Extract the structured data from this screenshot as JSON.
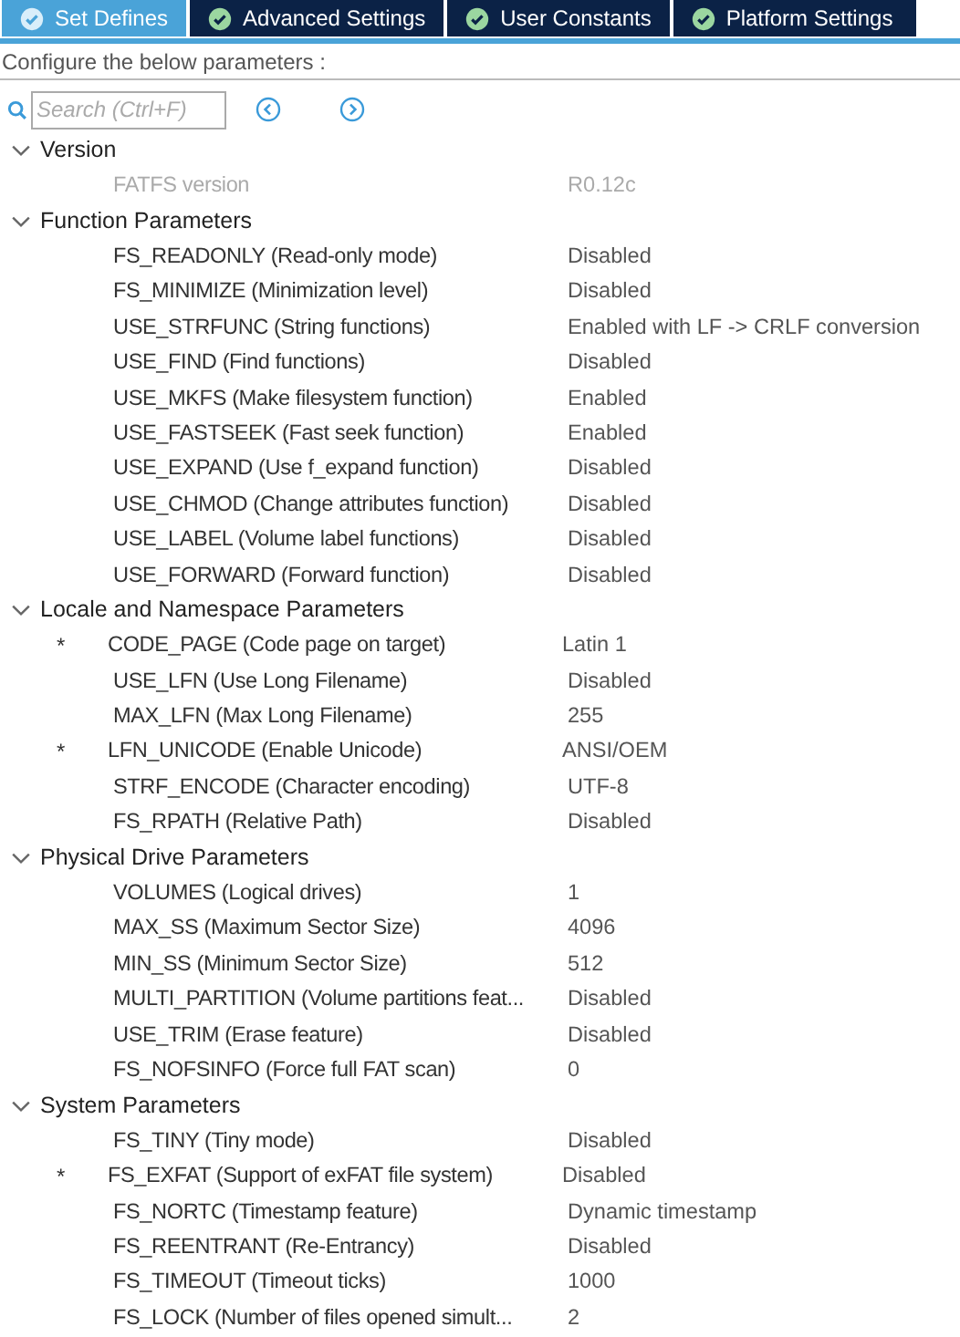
{
  "tabs": [
    {
      "label": "Set Defines",
      "selected": true
    },
    {
      "label": "Advanced Settings",
      "selected": false
    },
    {
      "label": "User Constants",
      "selected": false
    },
    {
      "label": "Platform Settings",
      "selected": false
    }
  ],
  "caption": "Configure the below parameters :",
  "search": {
    "placeholder": "Search (Ctrl+F)"
  },
  "groups": [
    {
      "title": "Version",
      "expanded": true,
      "params": [
        {
          "name": "FATFS version",
          "value": "R0.12c",
          "starred": false,
          "disabled": true
        }
      ]
    },
    {
      "title": "Function Parameters",
      "expanded": true,
      "params": [
        {
          "name": "FS_READONLY (Read-only mode)",
          "value": "Disabled",
          "starred": false,
          "disabled": false
        },
        {
          "name": "FS_MINIMIZE (Minimization level)",
          "value": "Disabled",
          "starred": false,
          "disabled": false
        },
        {
          "name": "USE_STRFUNC (String functions)",
          "value": "Enabled with LF -> CRLF conversion",
          "starred": false,
          "disabled": false
        },
        {
          "name": "USE_FIND (Find functions)",
          "value": "Disabled",
          "starred": false,
          "disabled": false
        },
        {
          "name": "USE_MKFS (Make filesystem function)",
          "value": "Enabled",
          "starred": false,
          "disabled": false
        },
        {
          "name": "USE_FASTSEEK (Fast seek function)",
          "value": "Enabled",
          "starred": false,
          "disabled": false
        },
        {
          "name": "USE_EXPAND (Use f_expand function)",
          "value": "Disabled",
          "starred": false,
          "disabled": false
        },
        {
          "name": "USE_CHMOD (Change attributes function)",
          "value": "Disabled",
          "starred": false,
          "disabled": false
        },
        {
          "name": "USE_LABEL (Volume label functions)",
          "value": "Disabled",
          "starred": false,
          "disabled": false
        },
        {
          "name": "USE_FORWARD (Forward function)",
          "value": "Disabled",
          "starred": false,
          "disabled": false
        }
      ]
    },
    {
      "title": "Locale and Namespace Parameters",
      "expanded": true,
      "params": [
        {
          "name": "CODE_PAGE (Code page on target)",
          "value": "Latin 1",
          "starred": true,
          "disabled": false
        },
        {
          "name": "USE_LFN (Use Long Filename)",
          "value": "Disabled",
          "starred": false,
          "disabled": false
        },
        {
          "name": "MAX_LFN (Max Long Filename)",
          "value": "255",
          "starred": false,
          "disabled": false
        },
        {
          "name": "LFN_UNICODE (Enable Unicode)",
          "value": "ANSI/OEM",
          "starred": true,
          "disabled": false
        },
        {
          "name": "STRF_ENCODE (Character encoding)",
          "value": "UTF-8",
          "starred": false,
          "disabled": false
        },
        {
          "name": "FS_RPATH (Relative Path)",
          "value": "Disabled",
          "starred": false,
          "disabled": false
        }
      ]
    },
    {
      "title": "Physical Drive Parameters",
      "expanded": true,
      "params": [
        {
          "name": "VOLUMES (Logical drives)",
          "value": "1",
          "starred": false,
          "disabled": false
        },
        {
          "name": "MAX_SS (Maximum Sector Size)",
          "value": "4096",
          "starred": false,
          "disabled": false
        },
        {
          "name": "MIN_SS (Minimum Sector Size)",
          "value": "512",
          "starred": false,
          "disabled": false
        },
        {
          "name": "MULTI_PARTITION (Volume partitions feat...",
          "value": "Disabled",
          "starred": false,
          "disabled": false
        },
        {
          "name": "USE_TRIM (Erase feature)",
          "value": "Disabled",
          "starred": false,
          "disabled": false
        },
        {
          "name": "FS_NOFSINFO (Force full FAT scan)",
          "value": "0",
          "starred": false,
          "disabled": false
        }
      ]
    },
    {
      "title": "System Parameters",
      "expanded": true,
      "params": [
        {
          "name": "FS_TINY (Tiny mode)",
          "value": "Disabled",
          "starred": false,
          "disabled": false
        },
        {
          "name": "FS_EXFAT (Support of exFAT file system)",
          "value": "Disabled",
          "starred": true,
          "disabled": false
        },
        {
          "name": "FS_NORTC (Timestamp feature)",
          "value": "Dynamic timestamp",
          "starred": false,
          "disabled": false
        },
        {
          "name": "FS_REENTRANT (Re-Entrancy)",
          "value": "Disabled",
          "starred": false,
          "disabled": false
        },
        {
          "name": "FS_TIMEOUT (Timeout ticks)",
          "value": "1000",
          "starred": false,
          "disabled": false
        },
        {
          "name": "FS_LOCK (Number of files opened simult...",
          "value": "2",
          "starred": false,
          "disabled": false
        }
      ]
    }
  ],
  "star_mark": "*"
}
